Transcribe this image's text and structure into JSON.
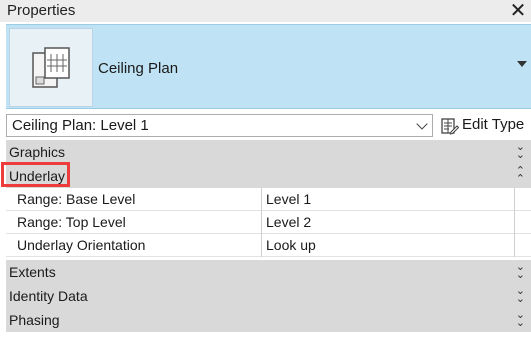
{
  "window": {
    "title": "Properties",
    "close_glyph": "✕"
  },
  "type_selector": {
    "type_name": "Ceiling Plan",
    "thumbnail_icon": "ceiling-plan-icon"
  },
  "instance_selector": {
    "value": "Ceiling Plan: Level 1"
  },
  "edit_type": {
    "label": "Edit Type",
    "icon": "edit-type-icon"
  },
  "groups": {
    "graphics": {
      "label": "Graphics",
      "state": "collapsed",
      "toggle": "⌄\n⌄"
    },
    "underlay": {
      "label": "Underlay",
      "state": "expanded",
      "toggle": "⌃\n⌃"
    },
    "extents": {
      "label": "Extents",
      "state": "collapsed",
      "toggle": "⌄\n⌄"
    },
    "identity_data": {
      "label": "Identity Data",
      "state": "collapsed",
      "toggle": "⌄\n⌄"
    },
    "phasing": {
      "label": "Phasing",
      "state": "collapsed",
      "toggle": "⌄\n⌄"
    }
  },
  "underlay_properties": [
    {
      "name": "Range: Base Level",
      "value": "Level 1"
    },
    {
      "name": "Range: Top Level",
      "value": "Level 2"
    },
    {
      "name": "Underlay Orientation",
      "value": "Look up"
    }
  ],
  "colors": {
    "type_panel_bg": "#bfe3f5",
    "group_header_bg": "#d9d9d9",
    "highlight_border": "#ee3b3b"
  }
}
